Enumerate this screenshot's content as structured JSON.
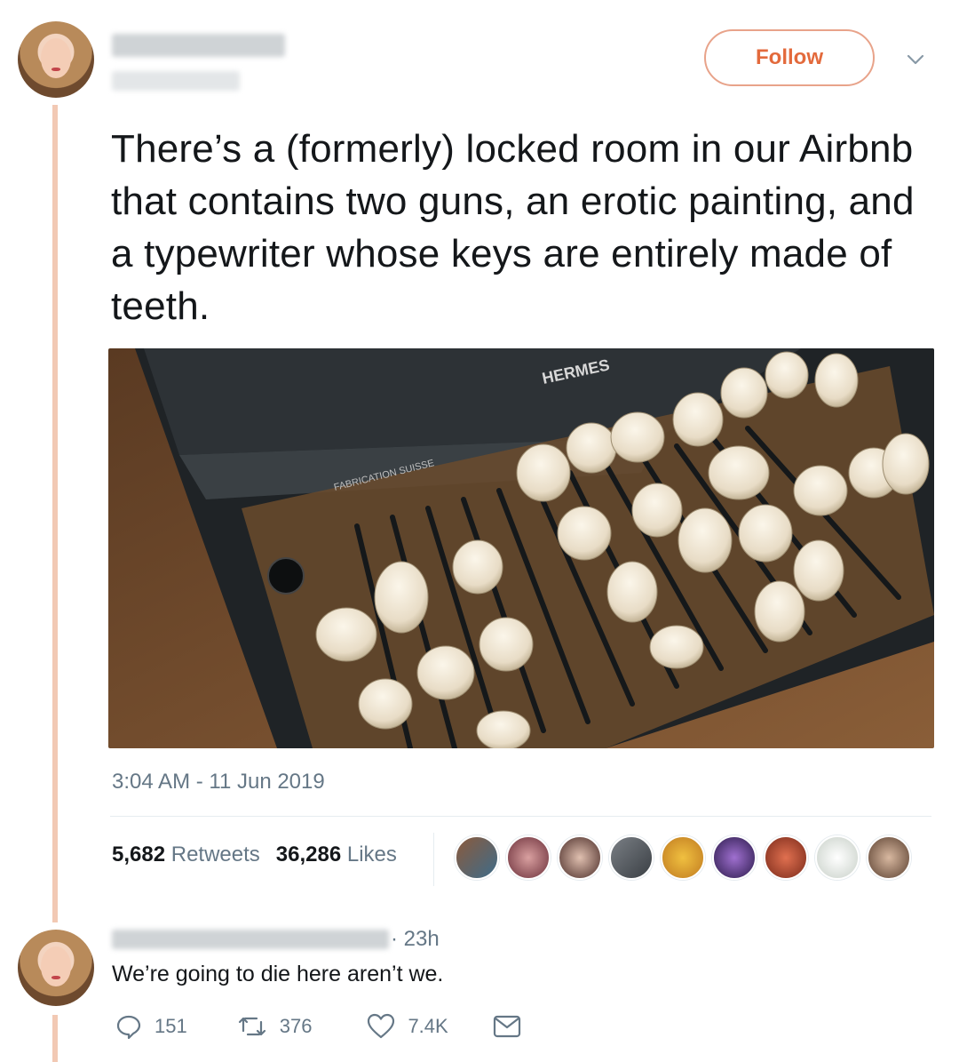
{
  "tweet": {
    "follow_label": "Follow",
    "text": "There’s a (formerly) locked room in our Airbnb that contains two guns, an erotic painting, and a typewriter whose keys are entirely made of teeth.",
    "media": {
      "brand": "HERMES",
      "subtitle": "FABRICATION SUISSE"
    },
    "timestamp": "3:04 AM - 11 Jun 2019",
    "retweets_count": "5,682",
    "retweets_label": "Retweets",
    "likes_count": "36,286",
    "likes_label": "Likes"
  },
  "reply": {
    "time": "· 23h",
    "text": "We’re going to die here aren’t we.",
    "replies": "151",
    "retweets": "376",
    "likes": "7.4K"
  },
  "colors": {
    "accent": "#e36a3c",
    "thread": "#f2c9b4",
    "muted": "#657786"
  }
}
